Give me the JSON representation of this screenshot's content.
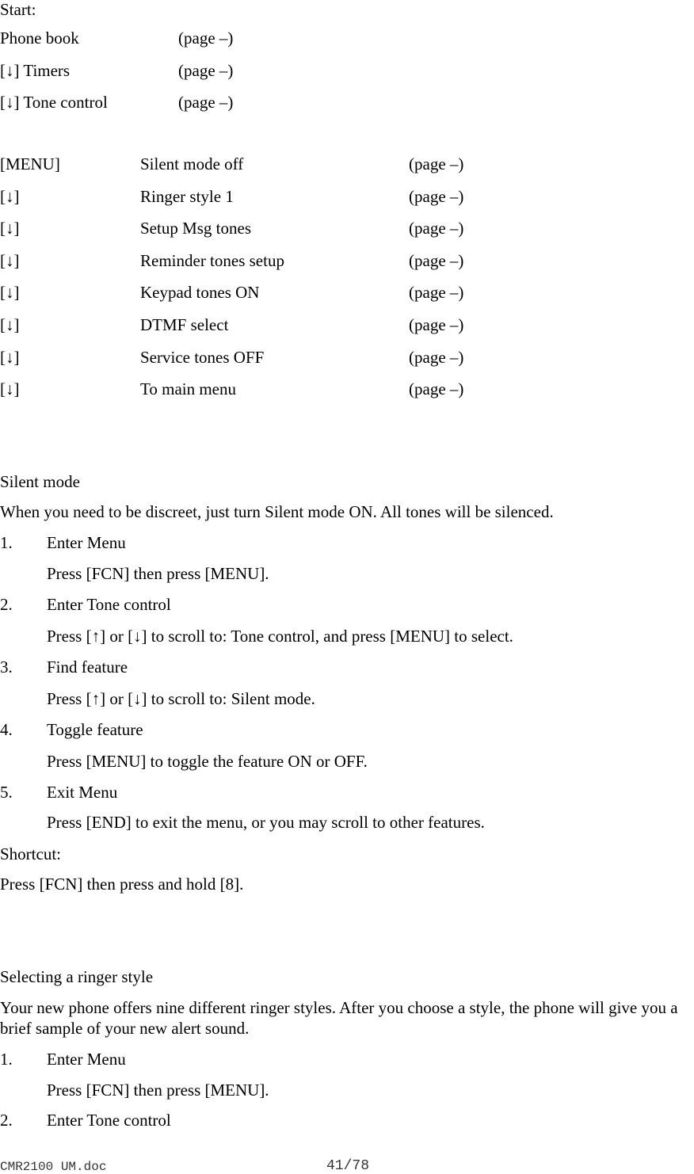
{
  "start_nav": {
    "label": "Start:",
    "rows": [
      {
        "item": "Phone book",
        "page": "(page –)"
      },
      {
        "item": "[↓] Timers",
        "page": "(page –)"
      },
      {
        "item": "[↓] Tone control",
        "page": "(page –)"
      }
    ]
  },
  "menu_list": [
    {
      "key": "[MENU]",
      "item": "Silent mode off",
      "page": "(page –)"
    },
    {
      "key": "[↓]",
      "item": "Ringer style 1",
      "page": "(page –)"
    },
    {
      "key": "[↓]",
      "item": "Setup Msg tones",
      "page": "(page –)"
    },
    {
      "key": "[↓]",
      "item": "Reminder tones setup",
      "page": "(page –)"
    },
    {
      "key": "[↓]",
      "item": "Keypad tones ON",
      "page": "(page –)"
    },
    {
      "key": "[↓]",
      "item": "DTMF select",
      "page": "(page –)"
    },
    {
      "key": "[↓]",
      "item": "Service tones OFF",
      "page": "(page –)"
    },
    {
      "key": "[↓]",
      "item": "To main menu",
      "page": "(page –)"
    }
  ],
  "silent_mode": {
    "heading": "Silent mode",
    "intro": "When you need to be discreet, just turn Silent mode ON. All tones will be silenced.",
    "steps": [
      {
        "num": "1.",
        "title": "Enter Menu",
        "detail": "Press [FCN] then press [MENU]."
      },
      {
        "num": "2.",
        "title": "Enter Tone control",
        "detail": "Press [↑] or [↓] to scroll to: Tone control, and press [MENU] to select."
      },
      {
        "num": "3.",
        "title": "Find feature",
        "detail": "Press [↑] or [↓] to scroll to: Silent mode."
      },
      {
        "num": "4.",
        "title": "Toggle feature",
        "detail": "Press [MENU] to toggle the feature ON or OFF."
      },
      {
        "num": "5.",
        "title": "Exit Menu",
        "detail": "Press [END] to exit the menu, or you may scroll to other features."
      }
    ],
    "shortcut_label": "Shortcut:",
    "shortcut_text": "Press [FCN] then press and hold [8]."
  },
  "ringer_style": {
    "heading": "Selecting a ringer style",
    "intro": "Your new phone offers nine different ringer styles. After you choose a style, the phone will give you a brief sample of your new alert sound.",
    "steps": [
      {
        "num": "1.",
        "title": "Enter Menu",
        "detail": "Press [FCN] then press [MENU]."
      },
      {
        "num": "2.",
        "title": "Enter Tone control"
      }
    ]
  },
  "footer": {
    "filename": "CMR2100 UM.doc",
    "page": "41/78"
  }
}
